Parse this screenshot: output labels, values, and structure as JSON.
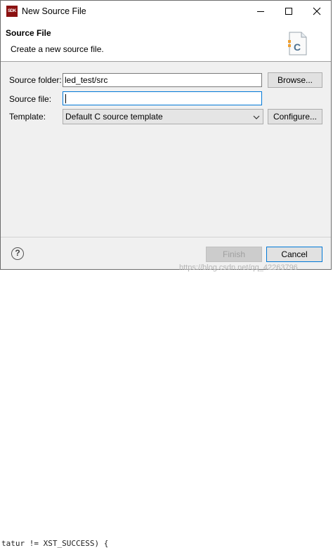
{
  "window": {
    "app_icon_text": "SDK",
    "title": "New Source File"
  },
  "header": {
    "title": "Source File",
    "description": "Create a new source file.",
    "file_icon_letter": "C"
  },
  "form": {
    "source_folder": {
      "label": "Source folder:",
      "value": "led_test/src",
      "button": "Browse..."
    },
    "source_file": {
      "label": "Source file:",
      "value": ""
    },
    "template": {
      "label": "Template:",
      "value": "Default C source template",
      "button": "Configure..."
    }
  },
  "footer": {
    "help_symbol": "?",
    "finish_label": "Finish",
    "cancel_label": "Cancel"
  },
  "background": {
    "code_line": "tatur != XST_SUCCESS) {",
    "watermark": "https://blog.csdn.net/qq_42263796"
  },
  "colors": {
    "accent": "#0078d7",
    "app_icon": "#8b1111"
  }
}
